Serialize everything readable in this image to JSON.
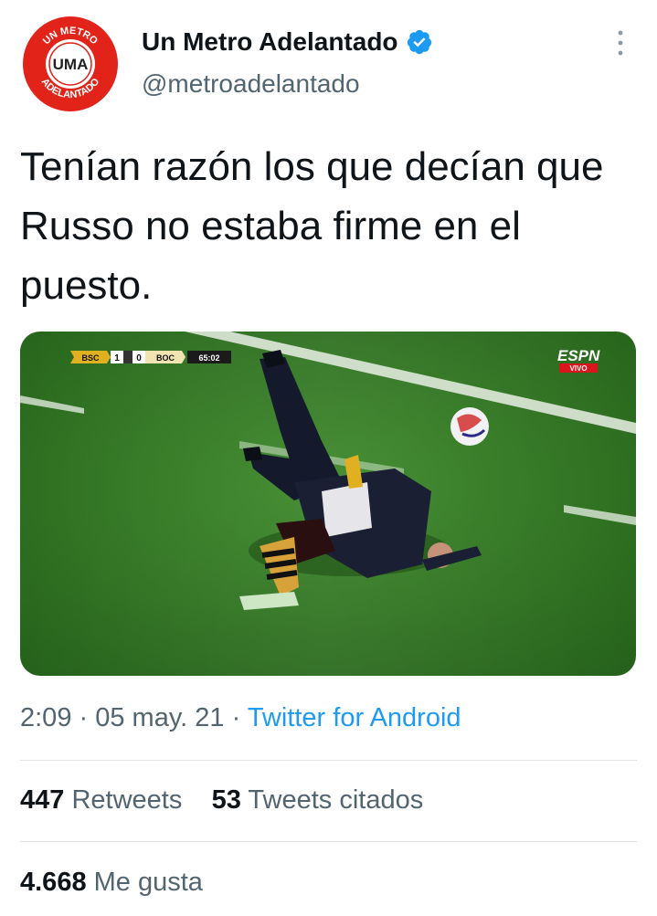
{
  "author": {
    "name": "Un Metro Adelantado",
    "handle": "@metroadelantado",
    "verified": true,
    "avatar_logo": {
      "top_text": "UN METRO",
      "center_text": "UMA",
      "bottom_text": "ADELANTADO",
      "color": "#e2231a"
    }
  },
  "tweet": {
    "text": "Tenían razón los que decían que Russo no estaba firme en el puesto."
  },
  "media": {
    "scoreboard": {
      "home": "BSC",
      "home_score": "1",
      "away_score": "0",
      "away": "BOC",
      "clock": "65:02"
    },
    "broadcaster": "ESPN",
    "live_label": "VIVO"
  },
  "meta": {
    "time": "2:09",
    "separator1": " · ",
    "date": "05 may. 21",
    "separator2": " · ",
    "source": "Twitter for Android"
  },
  "stats": {
    "retweets_count": "447",
    "retweets_label": "Retweets",
    "quotes_count": "53",
    "quotes_label": "Tweets citados",
    "likes_count": "4.668",
    "likes_label": "Me gusta"
  },
  "colors": {
    "accent": "#1d9bf0",
    "secondary_text": "#536471",
    "primary_text": "#0f1419"
  },
  "icons": [
    "verified-badge-icon",
    "more-options-icon"
  ]
}
